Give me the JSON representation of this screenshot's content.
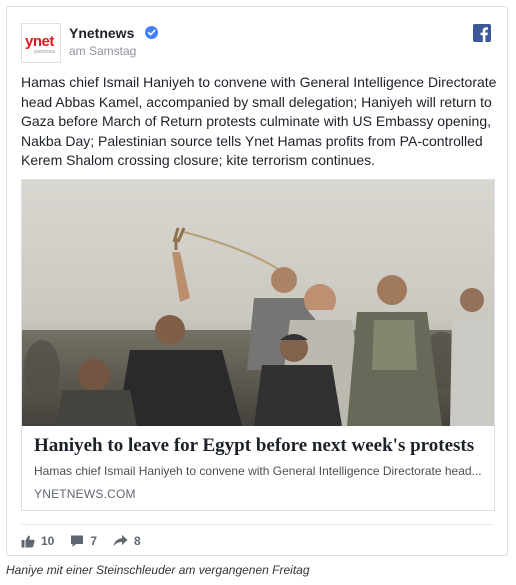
{
  "post": {
    "page_name": "Ynetnews",
    "timestamp": "am Samstag",
    "avatar_logo": "ynet",
    "avatar_sub": "ynetnews",
    "text": "Hamas chief Ismail Haniyeh to convene with General Intelligence Directorate head Abbas Kamel, accompanied by small delegation; Haniyeh will return to Gaza before March of Return protests culminate with US Embassy opening, Nakba Day; Palestinian source tells Ynet Hamas profits from PA-controlled Kerem Shalom crossing closure; kite terrorism continues."
  },
  "link": {
    "title": "Haniyeh to leave for Egypt before next week's protests",
    "description": "Hamas chief Ismail Haniyeh to convene with General Intelligence Directorate head...",
    "domain": "YNETNEWS.COM"
  },
  "actions": {
    "likes": "10",
    "comments": "7",
    "shares": "8"
  },
  "caption": "Haniye mit einer Steinschleuder am vergangenen Freitag",
  "colors": {
    "facebook_blue": "#3b5998",
    "verified_blue": "#4080ff",
    "ynet_red": "#e0191b"
  },
  "icons": [
    "verified-badge-icon",
    "facebook-icon",
    "like-icon",
    "comment-icon",
    "share-icon"
  ]
}
